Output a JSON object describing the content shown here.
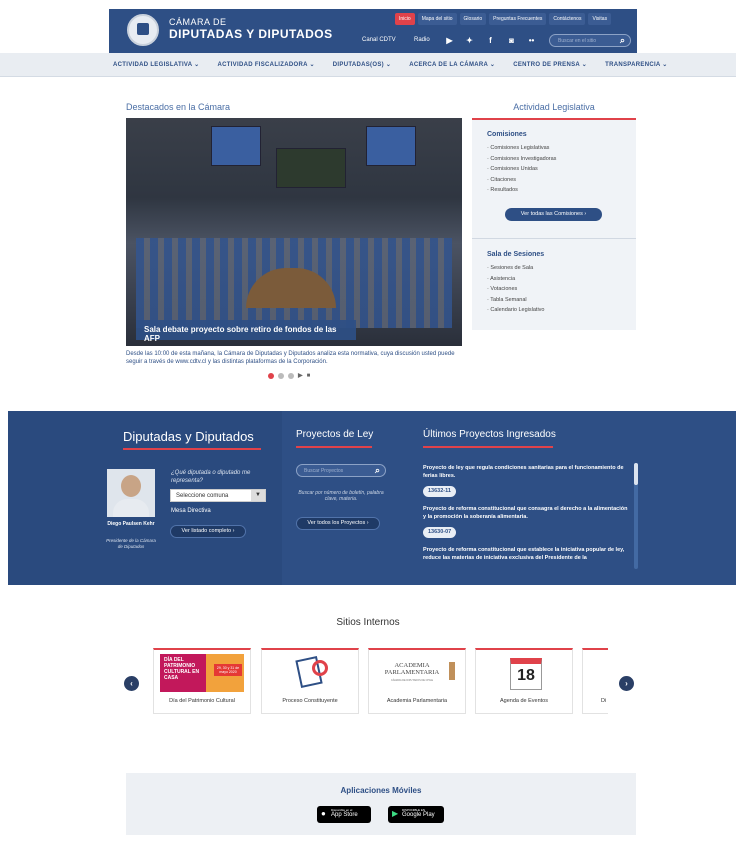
{
  "header": {
    "logo_line1": "CÁMARA DE",
    "logo_line2": "DIPUTADAS Y DIPUTADOS",
    "top_links": [
      "Inicio",
      "Mapa del sitio",
      "Glosario",
      "Preguntas Frecuentes",
      "Contáctenos",
      "Visitas"
    ],
    "canal": "Canal CDTV",
    "radio": "Radio",
    "search_placeholder": "Buscar en el sitio",
    "social_icons": [
      "youtube-icon",
      "twitter-icon",
      "facebook-icon",
      "instagram-icon",
      "flickr-icon"
    ]
  },
  "nav": {
    "items": [
      "ACTIVIDAD LEGISLATIVA ⌄",
      "ACTIVIDAD FISCALIZADORA ⌄",
      "DIPUTADAS(OS) ⌄",
      "ACERCA DE LA CÁMARA ⌄",
      "CENTRO DE PRENSA ⌄",
      "TRANSPARENCIA ⌄"
    ]
  },
  "destacados": {
    "title": "Destacados en la Cámara",
    "caption": "Sala debate proyecto sobre retiro de fondos de las AFP",
    "text": "Desde las 10:00 de esta mañana, la Cámara de Diputadas y Diputados analiza esta normativa, cuya discusión usted puede seguir a través de www.cdtv.cl y las distintas plataformas de la Corporación."
  },
  "actividad": {
    "title": "Actividad Legislativa",
    "comisiones_title": "Comisiones",
    "comisiones": [
      "Comisiones Legislativas",
      "Comisiones Investigadoras",
      "Comisiones Unidas",
      "Citaciones",
      "Resultados"
    ],
    "comisiones_button": "Ver todas las Comisiones ›",
    "sala_title": "Sala de Sesiones",
    "sala": [
      "Sesiones de Sala",
      "Asistencia",
      "Votaciones",
      "Tabla Semanal",
      "Calendario Legislativo"
    ]
  },
  "diputados": {
    "title": "Diputadas y Diputados",
    "person_name": "Diego Paulsen Kehr",
    "person_role": "Presidente de la Cámara de Diputados",
    "question": "¿Qué diputada o diputado me representa?",
    "select_value": "Seleccione comuna",
    "mesa": "Mesa Directiva",
    "listado_button": "Ver listado completo ›"
  },
  "proyectos": {
    "title": "Proyectos de Ley",
    "search_placeholder": "Buscar Proyectos",
    "hint": "Buscar por número de boletín, palabra clave, materia.",
    "button": "Ver todos los Proyectos ›"
  },
  "ultimos": {
    "title": "Últimos Proyectos Ingresados",
    "items": [
      {
        "text": "Proyecto de ley que regula condiciones sanitarias para el funcionamiento de ferias libres.",
        "code": "13632-11"
      },
      {
        "text": "Proyecto de reforma constitucional que consagra el derecho a la alimentación y la promoción la soberanía alimentaria.",
        "code": "13630-07"
      },
      {
        "text": "Proyecto de reforma constitucional que establece la iniciativa popular de ley, reduce las materias de iniciativa exclusiva del Presidente de la",
        "code": ""
      }
    ]
  },
  "sitios": {
    "title": "Sitios Internos",
    "cards": [
      {
        "label": "Día del Patrimonio Cultural",
        "img_text": "DÍA DEL PATRIMONIO CULTURAL EN CASA",
        "img_sub": "29, 30 y 31 de mayo 2020"
      },
      {
        "label": "Proceso Constituyente",
        "img_text": "",
        "img_sub": ""
      },
      {
        "label": "Academia Parlamentaria",
        "img_text": "ACADEMIA PARLAMENTARIA",
        "img_sub": "CÁMARA DE DIPUTADOS DE CHILE"
      },
      {
        "label": "Agenda de Eventos",
        "img_text": "18",
        "img_sub": ""
      },
      {
        "label": "Di",
        "img_text": "",
        "img_sub": ""
      }
    ]
  },
  "apps": {
    "title": "Aplicaciones Móviles",
    "appstore_small": "Disponible en el",
    "appstore": "App Store",
    "googleplay_small": "DISPONIBLE EN",
    "googleplay": "Google Play"
  },
  "colors": {
    "primary": "#2e4f85",
    "accent": "#e0424a",
    "panel": "#f0f3f7"
  }
}
